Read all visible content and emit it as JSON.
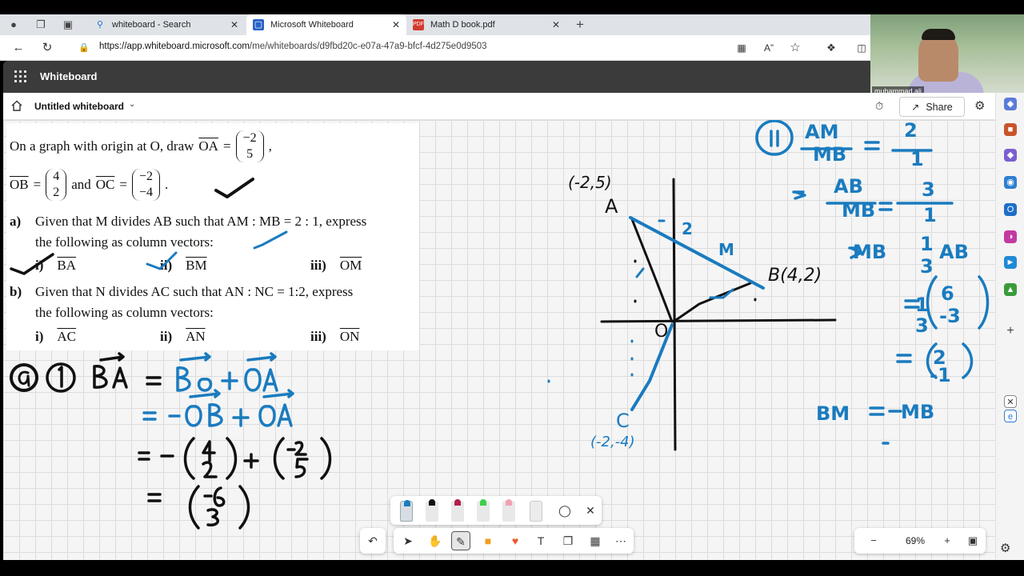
{
  "browser": {
    "tabs": [
      {
        "label": "whiteboard - Search",
        "icon": "search-icon"
      },
      {
        "label": "Microsoft Whiteboard",
        "icon": "whiteboard-icon"
      },
      {
        "label": "Math D book.pdf",
        "icon": "pdf-icon"
      }
    ],
    "url_host": "https://app.whiteboard.microsoft.com",
    "url_path": "/me/whiteboards/d9fbd20c-e07a-47a9-bfcf-4d275e0d9503"
  },
  "app": {
    "title": "Whiteboard"
  },
  "doc": {
    "name": "Untitled whiteboard",
    "share_label": "Share"
  },
  "webcam": {
    "name": "muhammad ali"
  },
  "question": {
    "line1_pre": "On a graph with origin at O, draw",
    "oa_label": "OA",
    "oa_top": "−2",
    "oa_bottom": "5",
    "ob_label": "OB",
    "ob_top": "4",
    "ob_bottom": "2",
    "and": "and",
    "oc_label": "OC",
    "oc_top": "−2",
    "oc_bottom": "−4",
    "a_label": "a)",
    "a_text1": "Given that M divides AB such that AM : MB = 2 : 1, express",
    "a_text2": "the following as column vectors:",
    "a_items": [
      {
        "num": "i)",
        "vec": "BA"
      },
      {
        "num": "ii)",
        "vec": "BM"
      },
      {
        "num": "iii)",
        "vec": "OM"
      }
    ],
    "b_label": "b)",
    "b_text1": "Given that N divides AC such that AN : NC = 1:2, express",
    "b_text2": "the following as column vectors:",
    "b_items": [
      {
        "num": "i)",
        "vec": "AC"
      },
      {
        "num": "ii)",
        "vec": "AN"
      },
      {
        "num": "iii)",
        "vec": "ON"
      }
    ]
  },
  "graph_labels": {
    "a_coord": "(-2,5)",
    "a": "A",
    "b": "B(4,2)",
    "c": "C",
    "c_coord": "(-2,-4)",
    "o": "O",
    "m": "M",
    "two": "2",
    "one": "1"
  },
  "zoom": {
    "value": "69%"
  },
  "colors": {
    "ink_blue": "#1a7bbf",
    "ink_black": "#111111",
    "appbar": "#3b3b3b"
  }
}
